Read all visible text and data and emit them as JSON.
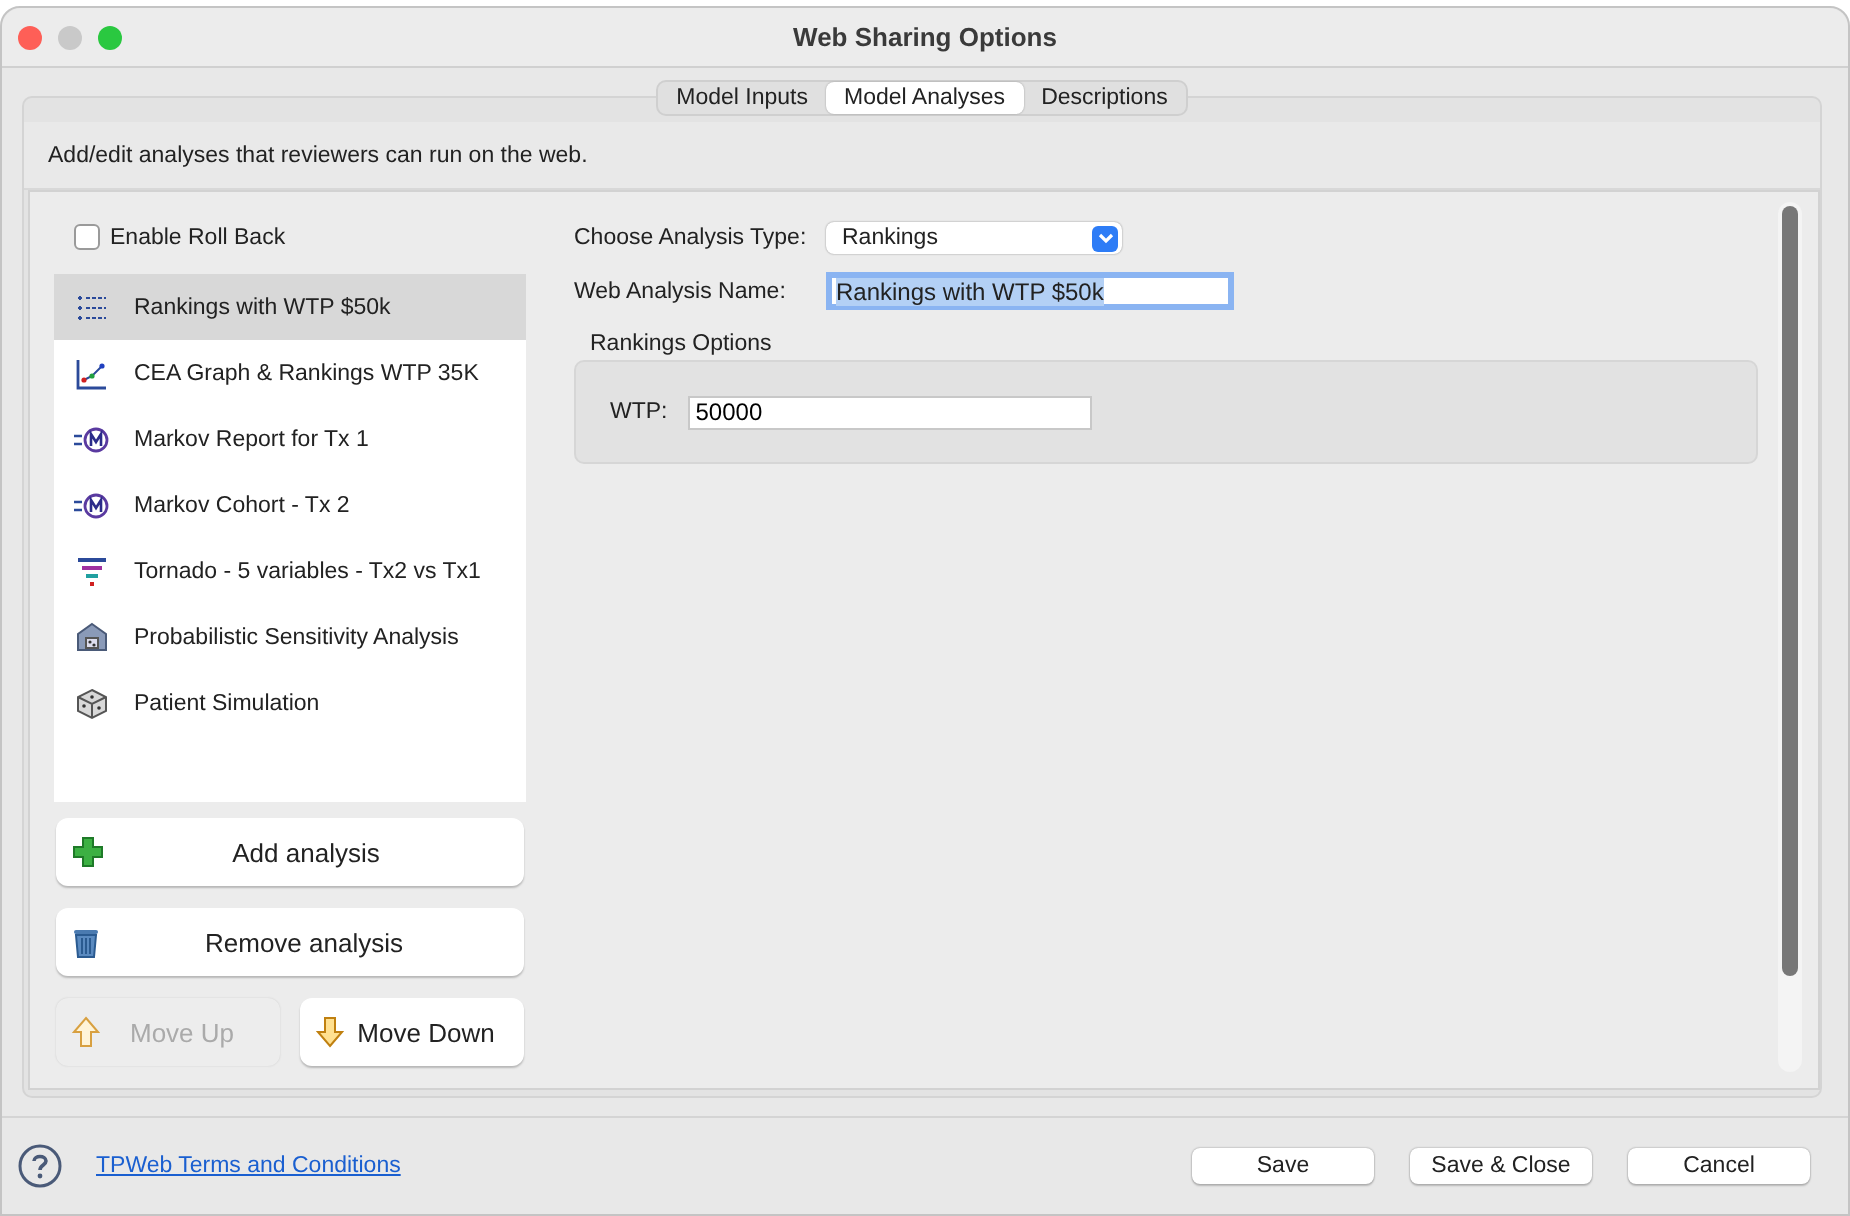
{
  "window": {
    "title": "Web Sharing Options"
  },
  "tabs": [
    {
      "label": "Model Inputs",
      "selected": false
    },
    {
      "label": "Model Analyses",
      "selected": true
    },
    {
      "label": "Descriptions",
      "selected": false
    }
  ],
  "description": "Add/edit analyses that reviewers can run on the web.",
  "roll_back": {
    "label": "Enable Roll Back",
    "checked": false
  },
  "analyses": [
    {
      "label": "Rankings with WTP $50k",
      "kind": "rankings",
      "selected": true
    },
    {
      "label": "CEA Graph & Rankings WTP 35K",
      "kind": "graph",
      "selected": false
    },
    {
      "label": "Markov Report for Tx 1",
      "kind": "markov",
      "selected": false
    },
    {
      "label": "Markov Cohort - Tx 2",
      "kind": "markov",
      "selected": false
    },
    {
      "label": "Tornado - 5 variables - Tx2 vs Tx1",
      "kind": "tornado",
      "selected": false
    },
    {
      "label": "Probabilistic Sensitivity Analysis",
      "kind": "psa",
      "selected": false
    },
    {
      "label": "Patient Simulation",
      "kind": "dice",
      "selected": false
    }
  ],
  "list_buttons": [
    {
      "label": "Add analysis",
      "kind": "add",
      "disabled": false
    },
    {
      "label": "Remove analysis",
      "kind": "remove",
      "disabled": false
    }
  ],
  "move_buttons": [
    {
      "label": "Move Up",
      "kind": "up",
      "disabled": true
    },
    {
      "label": "Move Down",
      "kind": "down",
      "disabled": false
    }
  ],
  "analysis_type": {
    "label": "Choose Analysis Type:",
    "value": "Rankings"
  },
  "analysis_name": {
    "label": "Web Analysis Name:",
    "value": "Rankings with WTP $50k"
  },
  "options_group": {
    "title": "Rankings Options",
    "fields": [
      {
        "label": "WTP:",
        "value": "50000"
      }
    ]
  },
  "footer": {
    "link": "TPWeb Terms and Conditions",
    "buttons": [
      "Save",
      "Save & Close",
      "Cancel"
    ]
  }
}
